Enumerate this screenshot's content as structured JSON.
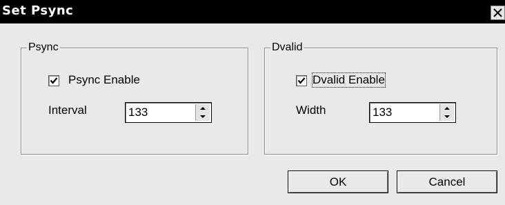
{
  "window": {
    "title": "Set Psync",
    "close_icon": "close-icon"
  },
  "psync_group": {
    "title": "Psync",
    "enable_label": "Psync Enable",
    "enable_checked": true,
    "interval_label": "Interval",
    "interval_value": "133"
  },
  "dvalid_group": {
    "title": "Dvalid",
    "enable_label": "Dvalid Enable",
    "enable_checked": true,
    "width_label": "Width",
    "width_value": "133"
  },
  "buttons": {
    "ok_label": "OK",
    "cancel_label": "Cancel"
  }
}
